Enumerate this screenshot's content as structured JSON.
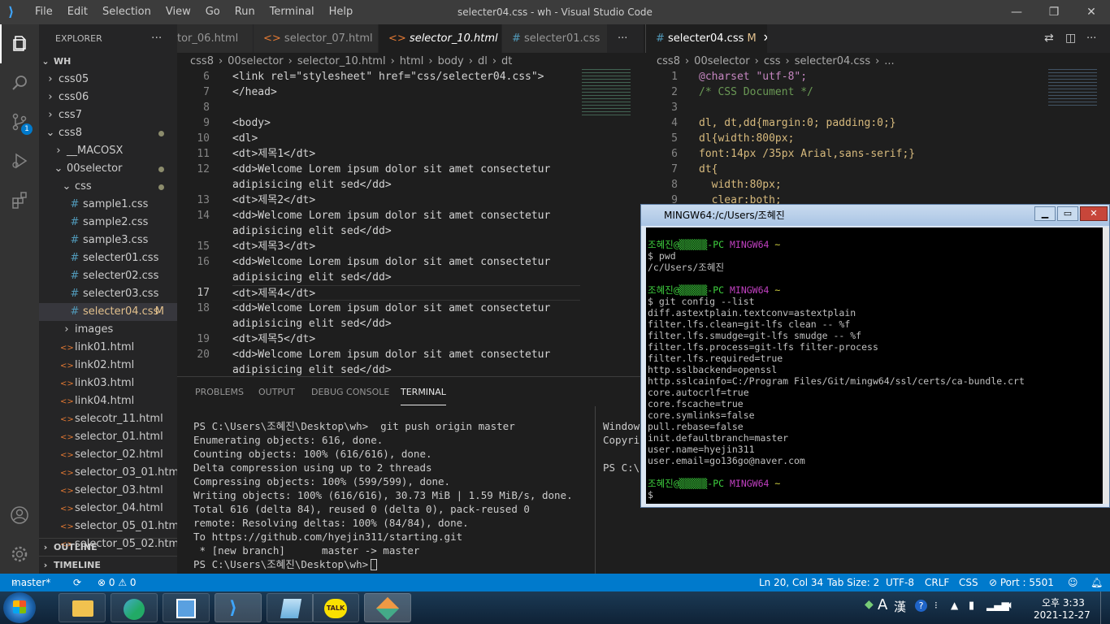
{
  "titlebar": {
    "menu": [
      "File",
      "Edit",
      "Selection",
      "View",
      "Go",
      "Run",
      "Terminal",
      "Help"
    ],
    "title": "selecter04.css - wh - Visual Studio Code"
  },
  "sidebar": {
    "header": "EXPLORER",
    "root": "WH",
    "items": [
      {
        "label": "css05",
        "type": "folder",
        "depth": 1
      },
      {
        "label": "css06",
        "type": "folder",
        "depth": 1
      },
      {
        "label": "css7",
        "type": "folder",
        "depth": 1
      },
      {
        "label": "css8",
        "type": "folder-open",
        "depth": 1
      },
      {
        "label": "__MACOSX",
        "type": "folder",
        "depth": 2
      },
      {
        "label": "00selector",
        "type": "folder-open",
        "depth": 2
      },
      {
        "label": "css",
        "type": "folder-open",
        "depth": 3
      },
      {
        "label": "sample1.css",
        "type": "css",
        "depth": 4
      },
      {
        "label": "sample2.css",
        "type": "css",
        "depth": 4
      },
      {
        "label": "sample3.css",
        "type": "css",
        "depth": 4
      },
      {
        "label": "selecter01.css",
        "type": "css",
        "depth": 4
      },
      {
        "label": "selecter02.css",
        "type": "css",
        "depth": 4
      },
      {
        "label": "selecter03.css",
        "type": "css",
        "depth": 4
      },
      {
        "label": "selecter04.css",
        "type": "css",
        "depth": 4,
        "badge": "M"
      },
      {
        "label": "images",
        "type": "folder",
        "depth": 3
      },
      {
        "label": "link01.html",
        "type": "html",
        "depth": 3
      },
      {
        "label": "link02.html",
        "type": "html",
        "depth": 3
      },
      {
        "label": "link03.html",
        "type": "html",
        "depth": 3
      },
      {
        "label": "link04.html",
        "type": "html",
        "depth": 3
      },
      {
        "label": "selecotr_11.html",
        "type": "html",
        "depth": 3
      },
      {
        "label": "selector_01.html",
        "type": "html",
        "depth": 3
      },
      {
        "label": "selector_02.html",
        "type": "html",
        "depth": 3
      },
      {
        "label": "selector_03_01.html",
        "type": "html",
        "depth": 3
      },
      {
        "label": "selector_03.html",
        "type": "html",
        "depth": 3
      },
      {
        "label": "selector_04.html",
        "type": "html",
        "depth": 3
      },
      {
        "label": "selector_05_01.html",
        "type": "html",
        "depth": 3
      },
      {
        "label": "selector_05_02.html",
        "type": "html",
        "depth": 3
      }
    ],
    "outline": "OUTLINE",
    "timeline": "TIMELINE"
  },
  "left_editor": {
    "tabs": [
      "tor_06.html",
      "selector_07.html",
      "selector_10.html",
      "selecter01.css"
    ],
    "breadcrumb": [
      "css8",
      "00selector",
      "selector_10.html",
      "html",
      "body",
      "dl",
      "dt"
    ],
    "lines": [
      {
        "n": "6",
        "text": "<link rel=\"stylesheet\" href=\"css/selecter04.css\">"
      },
      {
        "n": "7",
        "text": "</head>"
      },
      {
        "n": "8",
        "text": ""
      },
      {
        "n": "9",
        "text": "<body>"
      },
      {
        "n": "10",
        "text": "<dl>"
      },
      {
        "n": "11",
        "text": "<dt>제목1</dt>"
      },
      {
        "n": "12",
        "text": "<dd>Welcome Lorem ipsum dolor sit amet consectetur"
      },
      {
        "n": "",
        "text": "adipisicing elit sed</dd>"
      },
      {
        "n": "13",
        "text": "<dt>제목2</dt>"
      },
      {
        "n": "14",
        "text": "<dd>Welcome Lorem ipsum dolor sit amet consectetur"
      },
      {
        "n": "",
        "text": "adipisicing elit sed</dd>"
      },
      {
        "n": "15",
        "text": "<dt>제목3</dt>"
      },
      {
        "n": "16",
        "text": "<dd>Welcome Lorem ipsum dolor sit amet consectetur"
      },
      {
        "n": "",
        "text": "adipisicing elit sed</dd>"
      },
      {
        "n": "17",
        "text": "<dt>제목4</dt>"
      },
      {
        "n": "18",
        "text": "<dd>Welcome Lorem ipsum dolor sit amet consectetur"
      },
      {
        "n": "",
        "text": "adipisicing elit sed</dd>"
      },
      {
        "n": "19",
        "text": "<dt>제목5</dt>"
      },
      {
        "n": "20",
        "text": "<dd>Welcome Lorem ipsum dolor sit amet consectetur"
      },
      {
        "n": "",
        "text": "adipisicing elit sed</dd>"
      }
    ]
  },
  "right_editor": {
    "tab": "selecter04.css",
    "tab_badge": "M",
    "breadcrumb": [
      "css8",
      "00selector",
      "css",
      "selecter04.css",
      "..."
    ],
    "lines": [
      {
        "n": "1",
        "text": "@charset \"utf-8\";"
      },
      {
        "n": "2",
        "text": "/* CSS Document */"
      },
      {
        "n": "3",
        "text": ""
      },
      {
        "n": "4",
        "text": "dl, dt,dd{margin:0; padding:0;}"
      },
      {
        "n": "5",
        "text": "dl{width:800px;"
      },
      {
        "n": "6",
        "text": "font:14px /35px Arial,sans-serif;}"
      },
      {
        "n": "7",
        "text": "dt{"
      },
      {
        "n": "8",
        "text": "  width:80px;"
      },
      {
        "n": "9",
        "text": "  clear:both;"
      }
    ]
  },
  "panel": {
    "tabs": [
      "PROBLEMS",
      "OUTPUT",
      "DEBUG CONSOLE",
      "TERMINAL"
    ],
    "terminal": [
      "PS C:\\Users\\조혜진\\Desktop\\wh>  git push origin master",
      "Enumerating objects: 616, done.",
      "Counting objects: 100% (616/616), done.",
      "Delta compression using up to 2 threads",
      "Compressing objects: 100% (599/599), done.",
      "Writing objects: 100% (616/616), 30.73 MiB | 1.59 MiB/s, done.",
      "Total 616 (delta 84), reused 0 (delta 0), pack-reused 0",
      "remote: Resolving deltas: 100% (84/84), done.",
      "To https://github.com/hyejin311/starting.git",
      " * [new branch]      master -> master",
      "PS C:\\Users\\조혜진\\Desktop\\wh> "
    ],
    "terminal2": [
      "Windows",
      "Copyri",
      "",
      "PS C:\\"
    ]
  },
  "status": {
    "branch": "master*",
    "problems": "⊗ 0 ⚠ 0",
    "position": "Ln 20, Col 34",
    "tabsize": "Tab Size: 2",
    "encoding": "UTF-8",
    "eol": "CRLF",
    "lang": "CSS",
    "port": "⊘ Port : 5501"
  },
  "mingw": {
    "title": "MINGW64:/c/Users/조혜진",
    "lines": [
      {
        "t": "",
        "c": "#c0c0c0"
      },
      {
        "t": "조혜진@▒▒▒▒▒-PC MINGW64 ~",
        "c": "prompt"
      },
      {
        "t": "$ pwd",
        "c": "#c0c0c0"
      },
      {
        "t": "/c/Users/조혜진",
        "c": "#c0c0c0"
      },
      {
        "t": "",
        "c": "#c0c0c0"
      },
      {
        "t": "조혜진@▒▒▒▒▒-PC MINGW64 ~",
        "c": "prompt"
      },
      {
        "t": "$ git config --list",
        "c": "#c0c0c0"
      },
      {
        "t": "diff.astextplain.textconv=astextplain",
        "c": "#c0c0c0"
      },
      {
        "t": "filter.lfs.clean=git-lfs clean -- %f",
        "c": "#c0c0c0"
      },
      {
        "t": "filter.lfs.smudge=git-lfs smudge -- %f",
        "c": "#c0c0c0"
      },
      {
        "t": "filter.lfs.process=git-lfs filter-process",
        "c": "#c0c0c0"
      },
      {
        "t": "filter.lfs.required=true",
        "c": "#c0c0c0"
      },
      {
        "t": "http.sslbackend=openssl",
        "c": "#c0c0c0"
      },
      {
        "t": "http.sslcainfo=C:/Program Files/Git/mingw64/ssl/certs/ca-bundle.crt",
        "c": "#c0c0c0"
      },
      {
        "t": "core.autocrlf=true",
        "c": "#c0c0c0"
      },
      {
        "t": "core.fscache=true",
        "c": "#c0c0c0"
      },
      {
        "t": "core.symlinks=false",
        "c": "#c0c0c0"
      },
      {
        "t": "pull.rebase=false",
        "c": "#c0c0c0"
      },
      {
        "t": "init.defaultbranch=master",
        "c": "#c0c0c0"
      },
      {
        "t": "user.name=hyejin311",
        "c": "#c0c0c0"
      },
      {
        "t": "user.email=go136go@naver.com",
        "c": "#c0c0c0"
      },
      {
        "t": "",
        "c": "#c0c0c0"
      },
      {
        "t": "조혜진@▒▒▒▒▒-PC MINGW64 ~",
        "c": "prompt"
      },
      {
        "t": "$",
        "c": "#c0c0c0"
      }
    ]
  },
  "clock": {
    "time": "오후 3:33",
    "date": "2021-12-27"
  },
  "tray": {
    "ime": "A",
    "hanja": "漢"
  }
}
